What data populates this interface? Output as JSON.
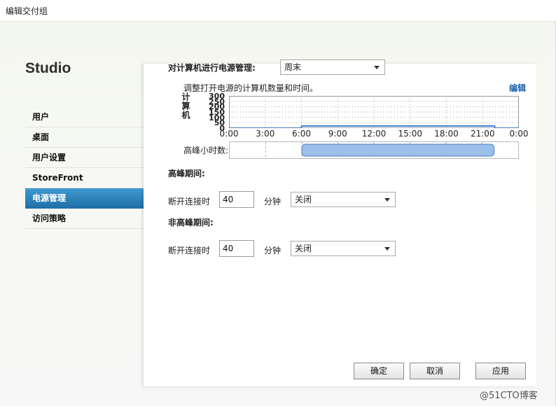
{
  "window": {
    "title": "编辑交付组"
  },
  "sidebar": {
    "brand": "Studio",
    "items": [
      {
        "label": "用户"
      },
      {
        "label": "桌面"
      },
      {
        "label": "用户设置"
      },
      {
        "label": "StoreFront"
      },
      {
        "label": "电源管理"
      },
      {
        "label": "访问策略"
      }
    ],
    "active_index": 4
  },
  "power": {
    "manage_label": "对计算机进行电源管理:",
    "schedule_value": "周末",
    "adjust_text": "调整打开电源的计算机数量和时间。",
    "edit_link": "编辑",
    "peak_hours_label": "高峰小时数:",
    "peak_start_hour": 6,
    "peak_end_hour": 22
  },
  "chart_data": {
    "type": "area",
    "ylabel": "计算机",
    "yticks": [
      "300",
      "250",
      "200",
      "150",
      "100",
      "50",
      "0"
    ],
    "ylim": [
      0,
      300
    ],
    "xticks": [
      "0:00",
      "3:00",
      "6:00",
      "9:00",
      "12:00",
      "15:00",
      "18:00",
      "21:00",
      "0:00"
    ],
    "x": [
      0,
      6,
      6,
      22,
      22,
      24
    ],
    "y": [
      0,
      0,
      20,
      20,
      0,
      0
    ],
    "grid": true
  },
  "peak": {
    "heading": "高峰期间:",
    "disconnect_label": "断开连接时",
    "disconnect_value": "40",
    "unit": "分钟",
    "action_value": "关闭"
  },
  "offpeak": {
    "heading": "非高峰期间:",
    "disconnect_label": "断开连接时",
    "disconnect_value": "40",
    "unit": "分钟",
    "action_value": "关闭"
  },
  "buttons": {
    "ok": "确定",
    "cancel": "取消",
    "apply": "应用"
  },
  "watermark": "@51CTO博客"
}
